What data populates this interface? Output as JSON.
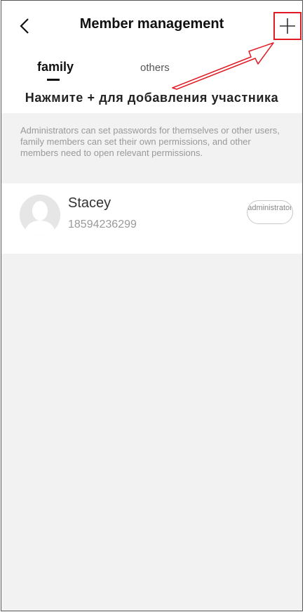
{
  "header": {
    "title": "Member management",
    "back_icon": "chevron-left-icon",
    "add_icon": "plus-icon",
    "highlight_color": "#e01b24"
  },
  "tabs": [
    {
      "label": "family",
      "active": true
    },
    {
      "label": "others",
      "active": false
    }
  ],
  "instruction": "Нажмите + для добавления участника",
  "note": "Administrators can set passwords for themselves or other users, family members can set their own permissions, and other members need to open relevant permissions.",
  "members": [
    {
      "name": "Stacey",
      "phone": "18594236299",
      "role": "administrator",
      "avatar_icon": "person-placeholder-icon"
    }
  ]
}
